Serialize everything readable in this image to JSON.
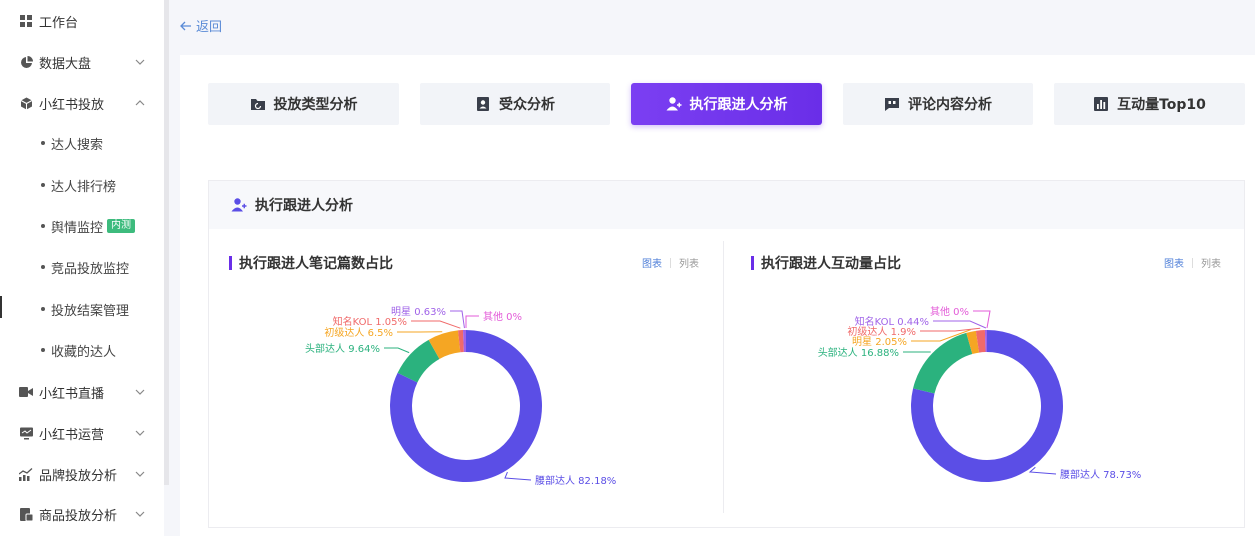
{
  "sidebar": {
    "items": [
      {
        "label": "工作台",
        "icon": "grid-icon",
        "chevron": false
      },
      {
        "label": "数据大盘",
        "icon": "pie-icon",
        "chevron": true,
        "expanded": false
      },
      {
        "label": "小红书投放",
        "icon": "cube-icon",
        "chevron": true,
        "expanded": true
      },
      {
        "label": "小红书直播",
        "icon": "video-icon",
        "chevron": true,
        "expanded": false
      },
      {
        "label": "小红书运营",
        "icon": "monitor-icon",
        "chevron": true,
        "expanded": false
      },
      {
        "label": "品牌投放分析",
        "icon": "trend-icon",
        "chevron": true,
        "expanded": false
      },
      {
        "label": "商品投放分析",
        "icon": "goods-icon",
        "chevron": true,
        "expanded": false
      }
    ],
    "subitems": [
      {
        "label": "达人搜索"
      },
      {
        "label": "达人排行榜"
      },
      {
        "label": "舆情监控",
        "badge": "内测"
      },
      {
        "label": "竞品投放监控"
      },
      {
        "label": "投放结案管理",
        "active": true
      },
      {
        "label": "收藏的达人"
      }
    ]
  },
  "back_label": "返回",
  "tabs": [
    {
      "label": "投放类型分析",
      "icon": "folder-icon",
      "active": false
    },
    {
      "label": "受众分析",
      "icon": "id-card-icon",
      "active": false
    },
    {
      "label": "执行跟进人分析",
      "icon": "user-add-icon",
      "active": true
    },
    {
      "label": "评论内容分析",
      "icon": "comment-icon",
      "active": false
    },
    {
      "label": "互动量Top10",
      "icon": "bar-chart-icon",
      "active": false
    }
  ],
  "panel_title": "执行跟进人分析",
  "view_switch": {
    "chart": "图表",
    "list": "列表"
  },
  "colors": {
    "accent": "#6a2ee8",
    "link": "#4f7fd8"
  },
  "chart_data": [
    {
      "type": "pie",
      "title": "执行跟进人笔记篇数占比",
      "donut": true,
      "slices": [
        {
          "name": "腰部达人",
          "value": 82.18,
          "label": "82.18%",
          "color": "#5b4ee6"
        },
        {
          "name": "头部达人",
          "value": 9.64,
          "label": "9.64%",
          "color": "#2bb27e"
        },
        {
          "name": "初级达人",
          "value": 6.5,
          "label": "6.5%",
          "color": "#f5a623"
        },
        {
          "name": "知名KOL",
          "value": 1.05,
          "label": "1.05%",
          "color": "#f06a6a"
        },
        {
          "name": "明星",
          "value": 0.63,
          "label": "0.63%",
          "color": "#a063e8"
        },
        {
          "name": "其他",
          "value": 0,
          "label": "0%",
          "color": "#e35bd8"
        }
      ]
    },
    {
      "type": "pie",
      "title": "执行跟进人互动量占比",
      "donut": true,
      "slices": [
        {
          "name": "腰部达人",
          "value": 78.73,
          "label": "78.73%",
          "color": "#5b4ee6"
        },
        {
          "name": "头部达人",
          "value": 16.88,
          "label": "16.88%",
          "color": "#2bb27e"
        },
        {
          "name": "明星",
          "value": 2.05,
          "label": "2.05%",
          "color": "#f5a623"
        },
        {
          "name": "初级达人",
          "value": 1.9,
          "label": "1.9%",
          "color": "#f06a6a"
        },
        {
          "name": "知名KOL",
          "value": 0.44,
          "label": "0.44%",
          "color": "#a063e8"
        },
        {
          "name": "其他",
          "value": 0,
          "label": "0%",
          "color": "#e35bd8"
        }
      ]
    }
  ]
}
